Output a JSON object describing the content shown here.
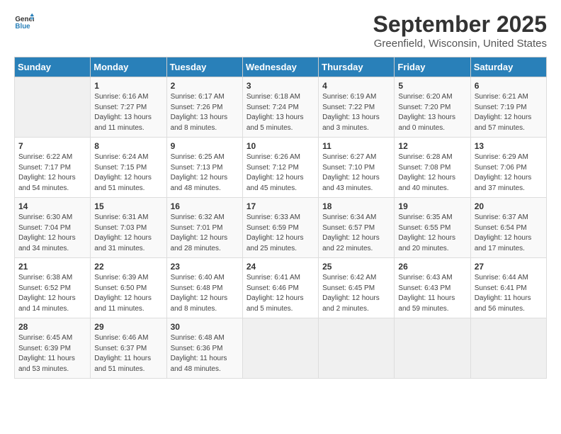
{
  "header": {
    "logo_general": "General",
    "logo_blue": "Blue",
    "title": "September 2025",
    "subtitle": "Greenfield, Wisconsin, United States"
  },
  "calendar": {
    "days_of_week": [
      "Sunday",
      "Monday",
      "Tuesday",
      "Wednesday",
      "Thursday",
      "Friday",
      "Saturday"
    ],
    "weeks": [
      [
        {
          "day": "",
          "info": ""
        },
        {
          "day": "1",
          "info": "Sunrise: 6:16 AM\nSunset: 7:27 PM\nDaylight: 13 hours\nand 11 minutes."
        },
        {
          "day": "2",
          "info": "Sunrise: 6:17 AM\nSunset: 7:26 PM\nDaylight: 13 hours\nand 8 minutes."
        },
        {
          "day": "3",
          "info": "Sunrise: 6:18 AM\nSunset: 7:24 PM\nDaylight: 13 hours\nand 5 minutes."
        },
        {
          "day": "4",
          "info": "Sunrise: 6:19 AM\nSunset: 7:22 PM\nDaylight: 13 hours\nand 3 minutes."
        },
        {
          "day": "5",
          "info": "Sunrise: 6:20 AM\nSunset: 7:20 PM\nDaylight: 13 hours\nand 0 minutes."
        },
        {
          "day": "6",
          "info": "Sunrise: 6:21 AM\nSunset: 7:19 PM\nDaylight: 12 hours\nand 57 minutes."
        }
      ],
      [
        {
          "day": "7",
          "info": "Sunrise: 6:22 AM\nSunset: 7:17 PM\nDaylight: 12 hours\nand 54 minutes."
        },
        {
          "day": "8",
          "info": "Sunrise: 6:24 AM\nSunset: 7:15 PM\nDaylight: 12 hours\nand 51 minutes."
        },
        {
          "day": "9",
          "info": "Sunrise: 6:25 AM\nSunset: 7:13 PM\nDaylight: 12 hours\nand 48 minutes."
        },
        {
          "day": "10",
          "info": "Sunrise: 6:26 AM\nSunset: 7:12 PM\nDaylight: 12 hours\nand 45 minutes."
        },
        {
          "day": "11",
          "info": "Sunrise: 6:27 AM\nSunset: 7:10 PM\nDaylight: 12 hours\nand 43 minutes."
        },
        {
          "day": "12",
          "info": "Sunrise: 6:28 AM\nSunset: 7:08 PM\nDaylight: 12 hours\nand 40 minutes."
        },
        {
          "day": "13",
          "info": "Sunrise: 6:29 AM\nSunset: 7:06 PM\nDaylight: 12 hours\nand 37 minutes."
        }
      ],
      [
        {
          "day": "14",
          "info": "Sunrise: 6:30 AM\nSunset: 7:04 PM\nDaylight: 12 hours\nand 34 minutes."
        },
        {
          "day": "15",
          "info": "Sunrise: 6:31 AM\nSunset: 7:03 PM\nDaylight: 12 hours\nand 31 minutes."
        },
        {
          "day": "16",
          "info": "Sunrise: 6:32 AM\nSunset: 7:01 PM\nDaylight: 12 hours\nand 28 minutes."
        },
        {
          "day": "17",
          "info": "Sunrise: 6:33 AM\nSunset: 6:59 PM\nDaylight: 12 hours\nand 25 minutes."
        },
        {
          "day": "18",
          "info": "Sunrise: 6:34 AM\nSunset: 6:57 PM\nDaylight: 12 hours\nand 22 minutes."
        },
        {
          "day": "19",
          "info": "Sunrise: 6:35 AM\nSunset: 6:55 PM\nDaylight: 12 hours\nand 20 minutes."
        },
        {
          "day": "20",
          "info": "Sunrise: 6:37 AM\nSunset: 6:54 PM\nDaylight: 12 hours\nand 17 minutes."
        }
      ],
      [
        {
          "day": "21",
          "info": "Sunrise: 6:38 AM\nSunset: 6:52 PM\nDaylight: 12 hours\nand 14 minutes."
        },
        {
          "day": "22",
          "info": "Sunrise: 6:39 AM\nSunset: 6:50 PM\nDaylight: 12 hours\nand 11 minutes."
        },
        {
          "day": "23",
          "info": "Sunrise: 6:40 AM\nSunset: 6:48 PM\nDaylight: 12 hours\nand 8 minutes."
        },
        {
          "day": "24",
          "info": "Sunrise: 6:41 AM\nSunset: 6:46 PM\nDaylight: 12 hours\nand 5 minutes."
        },
        {
          "day": "25",
          "info": "Sunrise: 6:42 AM\nSunset: 6:45 PM\nDaylight: 12 hours\nand 2 minutes."
        },
        {
          "day": "26",
          "info": "Sunrise: 6:43 AM\nSunset: 6:43 PM\nDaylight: 11 hours\nand 59 minutes."
        },
        {
          "day": "27",
          "info": "Sunrise: 6:44 AM\nSunset: 6:41 PM\nDaylight: 11 hours\nand 56 minutes."
        }
      ],
      [
        {
          "day": "28",
          "info": "Sunrise: 6:45 AM\nSunset: 6:39 PM\nDaylight: 11 hours\nand 53 minutes."
        },
        {
          "day": "29",
          "info": "Sunrise: 6:46 AM\nSunset: 6:37 PM\nDaylight: 11 hours\nand 51 minutes."
        },
        {
          "day": "30",
          "info": "Sunrise: 6:48 AM\nSunset: 6:36 PM\nDaylight: 11 hours\nand 48 minutes."
        },
        {
          "day": "",
          "info": ""
        },
        {
          "day": "",
          "info": ""
        },
        {
          "day": "",
          "info": ""
        },
        {
          "day": "",
          "info": ""
        }
      ]
    ]
  }
}
